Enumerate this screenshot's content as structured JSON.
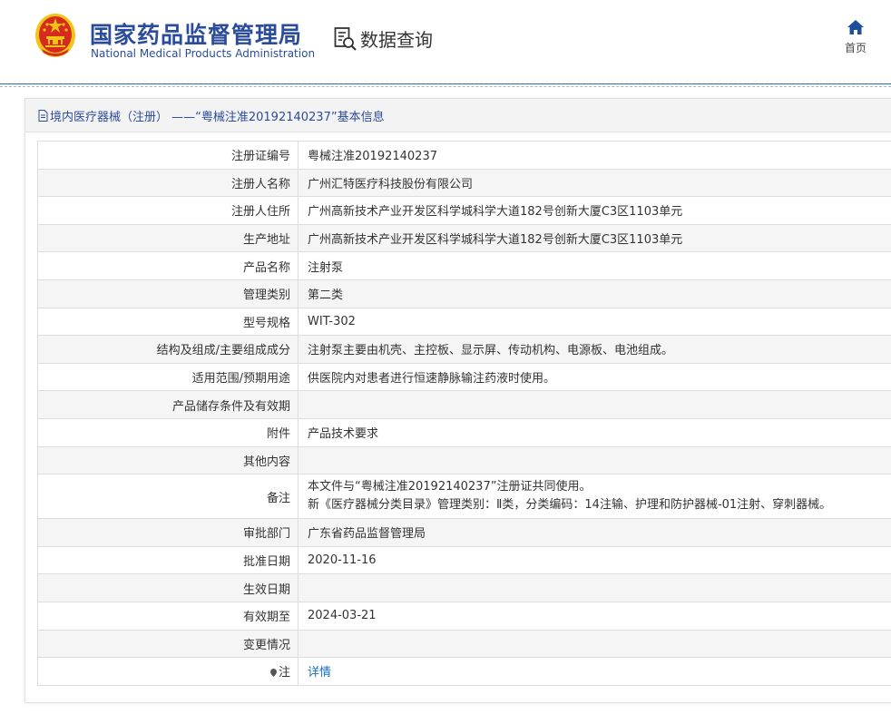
{
  "header": {
    "site_name_cn": "国家药品监督管理局",
    "site_name_en": "National Medical Products Administration",
    "query_label": "数据查询",
    "home_label": "首页"
  },
  "panel": {
    "title": "境内医疗器械（注册） ——“粤械注准20192140237”基本信息"
  },
  "rows": [
    {
      "key": "注册证编号",
      "value": "粤械注准20192140237"
    },
    {
      "key": "注册人名称",
      "value": "广州汇特医疗科技股份有限公司"
    },
    {
      "key": "注册人住所",
      "value": "广州高新技术产业开发区科学城科学大道182号创新大厦C3区1103单元"
    },
    {
      "key": "生产地址",
      "value": "广州高新技术产业开发区科学城科学大道182号创新大厦C3区1103单元"
    },
    {
      "key": "产品名称",
      "value": "注射泵"
    },
    {
      "key": "管理类别",
      "value": "第二类"
    },
    {
      "key": "型号规格",
      "value": "WIT-302"
    },
    {
      "key": "结构及组成/主要组成成分",
      "value": "注射泵主要由机壳、主控板、显示屏、传动机构、电源板、电池组成。"
    },
    {
      "key": "适用范围/预期用途",
      "value": "供医院内对患者进行恒速静脉输注药液时使用。"
    },
    {
      "key": "产品储存条件及有效期",
      "value": ""
    },
    {
      "key": "附件",
      "value": "产品技术要求"
    },
    {
      "key": "其他内容",
      "value": ""
    },
    {
      "key": "备注",
      "value": "",
      "lines": [
        "本文件与“粤械注准20192140237”注册证共同使用。",
        "新《医疗器械分类目录》管理类别：Ⅱ类，分类编码：14注输、护理和防护器械-01注射、穿刺器械。"
      ]
    },
    {
      "key": "审批部门",
      "value": "广东省药品监督管理局"
    },
    {
      "key": "批准日期",
      "value": "2020-11-16"
    },
    {
      "key": "生效日期",
      "value": ""
    },
    {
      "key": "有效期至",
      "value": "2024-03-21"
    },
    {
      "key": "变更情况",
      "value": ""
    },
    {
      "key": "注",
      "value": "详情",
      "link": true,
      "key_icon": "location-pin-icon"
    }
  ],
  "colors": {
    "brand_blue": "#2b4c9b",
    "link_blue": "#1a6cc5",
    "emblem_red": "#d52b1e",
    "emblem_gold": "#f3c316"
  }
}
